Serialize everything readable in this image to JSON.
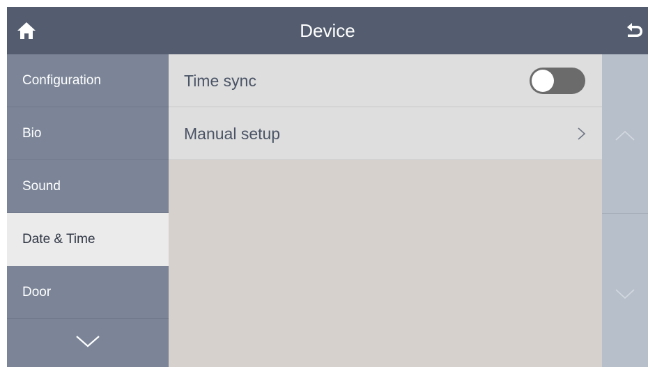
{
  "header": {
    "title": "Device",
    "home_icon": "home-icon",
    "back_icon": "back-arrow-icon"
  },
  "sidebar": {
    "items": [
      {
        "label": "Configuration",
        "active": false
      },
      {
        "label": "Bio",
        "active": false
      },
      {
        "label": "Sound",
        "active": false
      },
      {
        "label": "Date & Time",
        "active": true
      },
      {
        "label": "Door",
        "active": false
      }
    ],
    "more_icon": "chevron-down-icon"
  },
  "content": {
    "rows": [
      {
        "label": "Time sync",
        "control": "toggle",
        "toggle_on": false
      },
      {
        "label": "Manual setup",
        "control": "chevron-right-icon"
      }
    ]
  },
  "scroller": {
    "up_icon": "chevron-up-icon",
    "down_icon": "chevron-down-icon"
  },
  "colors": {
    "header_bg": "#535d6f",
    "sidebar_bg": "#7b8597",
    "sidebar_active_bg": "#ebebeb",
    "content_bg": "#d6d1cc",
    "row_bg": "#dedede",
    "scroller_bg": "#b7bfca",
    "toggle_off": "#6b6b6b"
  }
}
